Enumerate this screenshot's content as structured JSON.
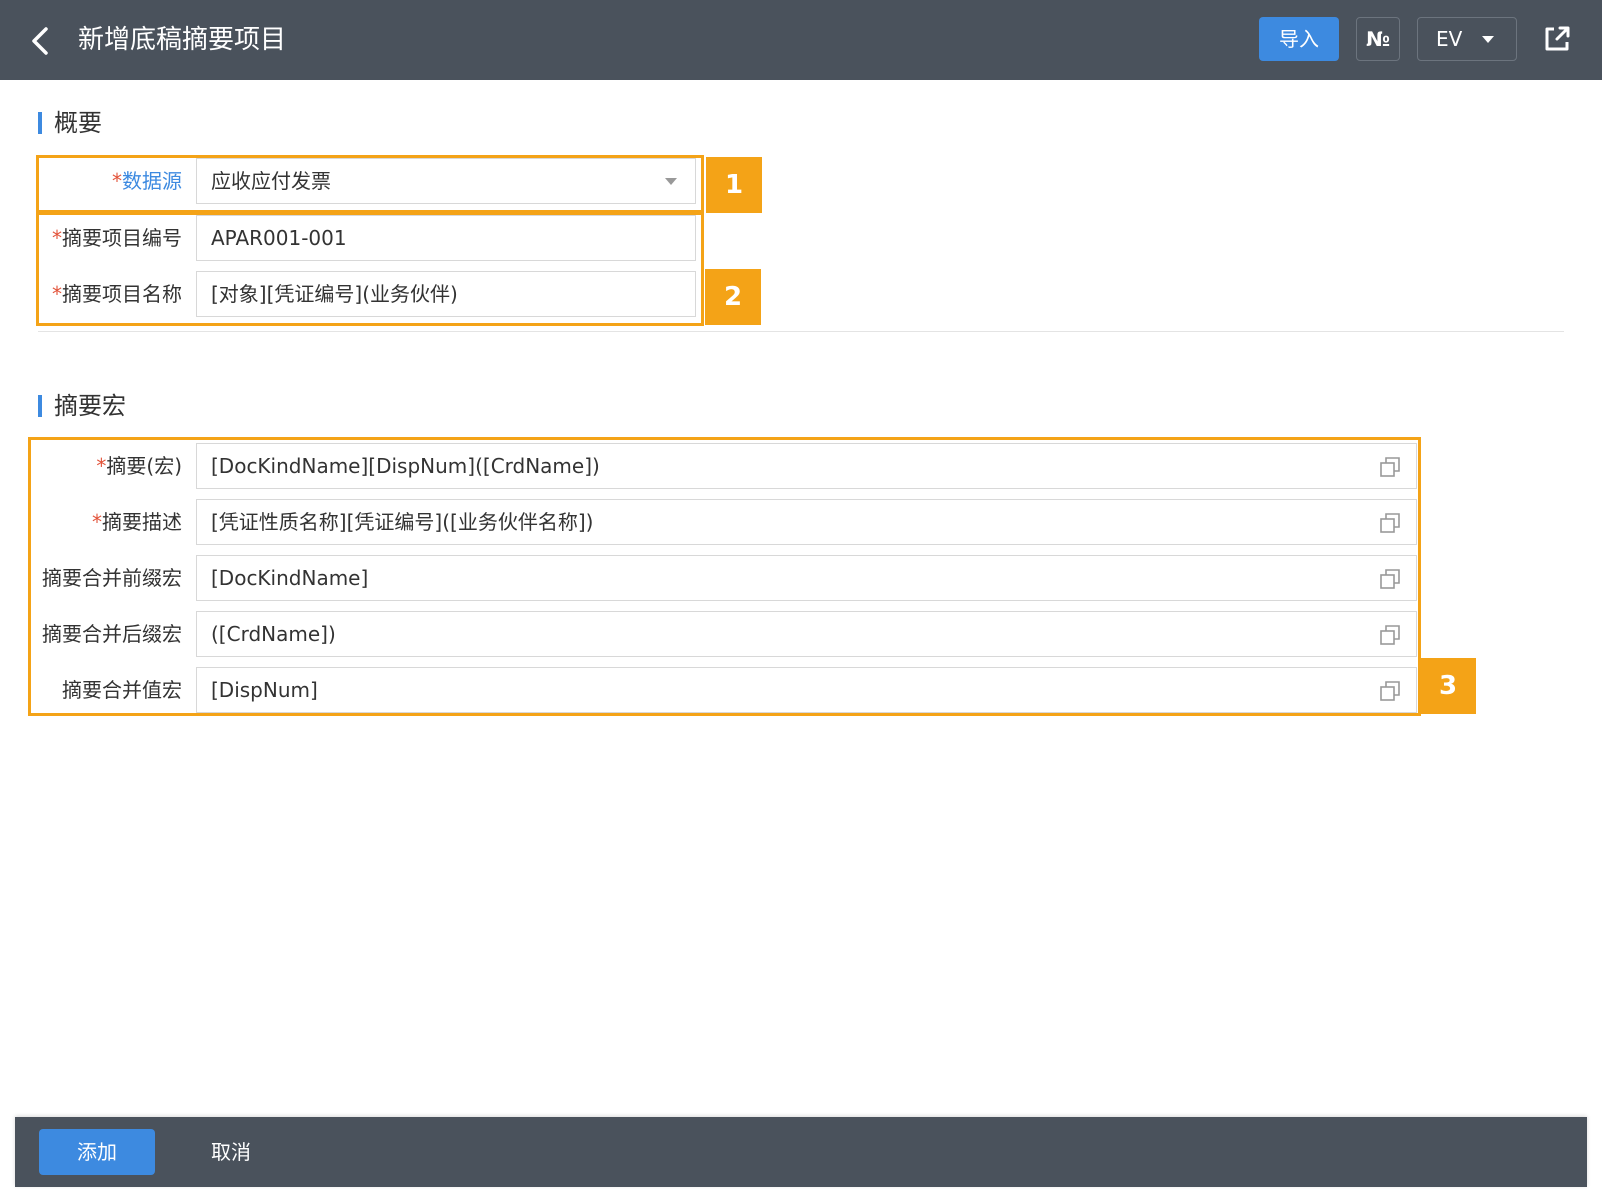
{
  "header": {
    "title": "新增底稿摘要项目",
    "import_label": "导入",
    "numero_label": "№",
    "ev_label": "EV"
  },
  "overview": {
    "section_title": "概要",
    "data_source": {
      "required": "*",
      "label": "数据源",
      "value": "应收应付发票"
    },
    "item_code": {
      "required": "*",
      "label": "摘要项目编号",
      "value": "APAR001-001"
    },
    "item_name": {
      "required": "*",
      "label": "摘要项目名称",
      "value": "[对象][凭证编号](业务伙伴)"
    }
  },
  "macro": {
    "section_title": "摘要宏",
    "fields": [
      {
        "required": "*",
        "label": "摘要(宏)",
        "value": "[DocKindName][DispNum]([CrdName])"
      },
      {
        "required": "*",
        "label": "摘要描述",
        "value": "[凭证性质名称][凭证编号]([业务伙伴名称])"
      },
      {
        "required": "",
        "label": "摘要合并前缀宏",
        "value": "[DocKindName]"
      },
      {
        "required": "",
        "label": "摘要合并后缀宏",
        "value": "([CrdName])"
      },
      {
        "required": "",
        "label": "摘要合并值宏",
        "value": "[DispNum]"
      }
    ]
  },
  "badges": [
    "1",
    "2",
    "3"
  ],
  "footer": {
    "add_label": "添加",
    "cancel_label": "取消"
  },
  "colors": {
    "header_bg": "#4a525c",
    "accent": "#3d8ae0",
    "highlight": "#f4a317",
    "required": "#e2533a"
  },
  "icons": [
    "back-arrow-icon",
    "share-icon",
    "copy-icon",
    "chevron-down-icon"
  ]
}
